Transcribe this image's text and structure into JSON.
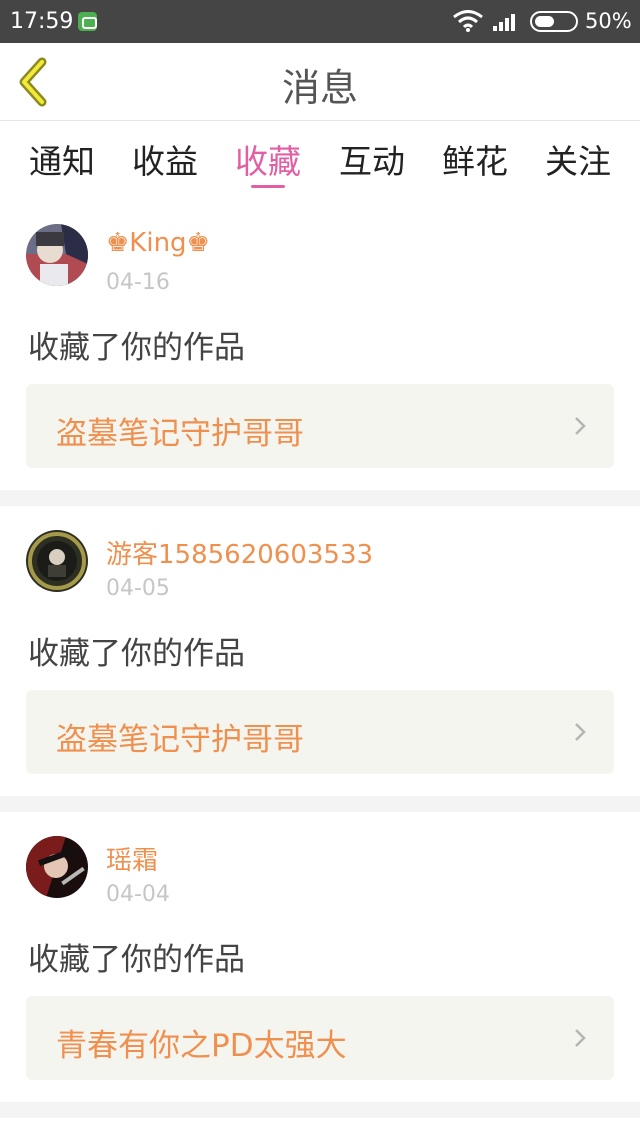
{
  "status_bar": {
    "time": "17:59",
    "battery": "50%",
    "battery_level": 0.5
  },
  "header": {
    "title": "消息",
    "back_icon": "chevron-left-icon"
  },
  "tabs": [
    {
      "label": "通知",
      "active": false
    },
    {
      "label": "收益",
      "active": false
    },
    {
      "label": "收藏",
      "active": true
    },
    {
      "label": "互动",
      "active": false
    },
    {
      "label": "鲜花",
      "active": false
    },
    {
      "label": "关注",
      "active": false
    }
  ],
  "colors": {
    "accent": "#e35fa3",
    "name": "#f0904f",
    "work_bg": "#f5f5f0"
  },
  "messages": [
    {
      "user": "♚King♚",
      "date": "04-16",
      "action": "收藏了你的作品",
      "work": "盗墓笔记守护哥哥"
    },
    {
      "user": "游客1585620603533",
      "date": "04-05",
      "action": "收藏了你的作品",
      "work": "盗墓笔记守护哥哥"
    },
    {
      "user": "瑶霜",
      "date": "04-04",
      "action": "收藏了你的作品",
      "work": "青春有你之PD太强大"
    }
  ]
}
